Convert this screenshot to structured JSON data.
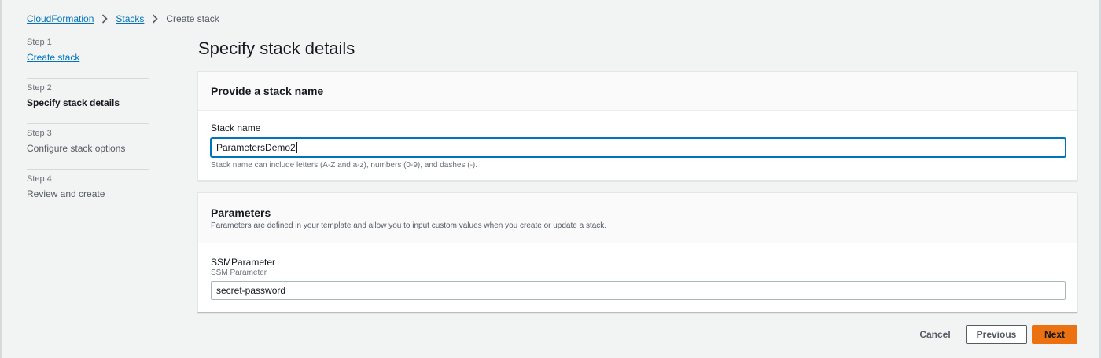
{
  "breadcrumb": {
    "items": [
      "CloudFormation",
      "Stacks",
      "Create stack"
    ]
  },
  "steps": [
    {
      "num": "Step 1",
      "label": "Create stack",
      "state": "link"
    },
    {
      "num": "Step 2",
      "label": "Specify stack details",
      "state": "current"
    },
    {
      "num": "Step 3",
      "label": "Configure stack options",
      "state": "disabled"
    },
    {
      "num": "Step 4",
      "label": "Review and create",
      "state": "disabled"
    }
  ],
  "page": {
    "title": "Specify stack details"
  },
  "stack_name_section": {
    "title": "Provide a stack name",
    "field_label": "Stack name",
    "value": "ParametersDemo2",
    "hint": "Stack name can include letters (A-Z and a-z), numbers (0-9), and dashes (-)."
  },
  "parameters_section": {
    "title": "Parameters",
    "description": "Parameters are defined in your template and allow you to input custom values when you create or update a stack.",
    "params": [
      {
        "name": "SSMParameter",
        "description": "SSM Parameter",
        "value": "secret-password"
      }
    ]
  },
  "footer": {
    "cancel": "Cancel",
    "previous": "Previous",
    "next": "Next"
  },
  "colors": {
    "link": "#0073bb",
    "primary_button": "#ec7211",
    "background": "#f2f3f3"
  }
}
